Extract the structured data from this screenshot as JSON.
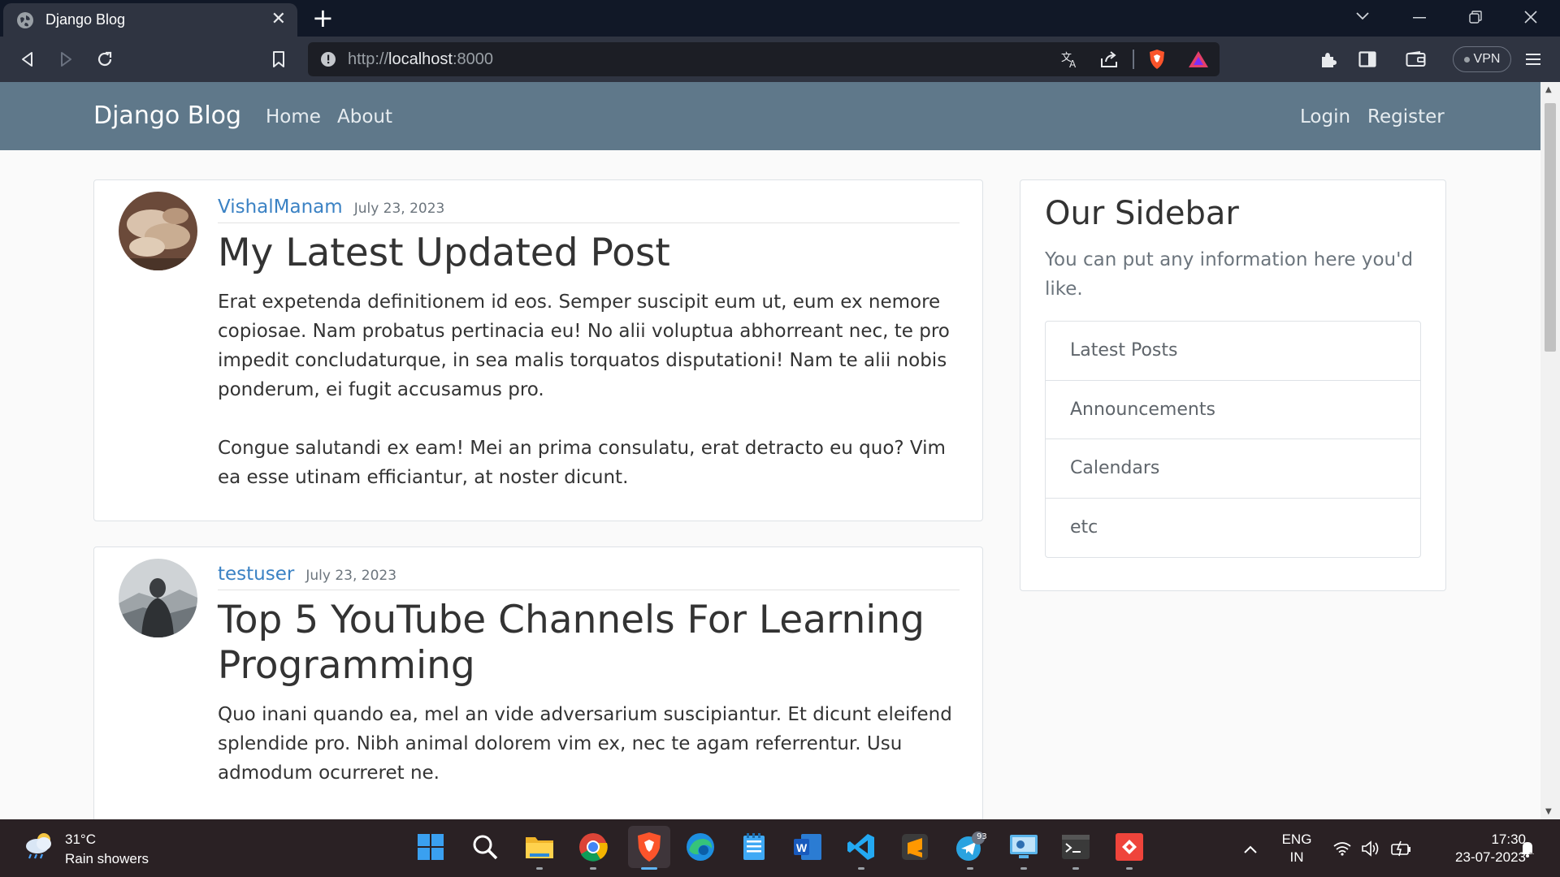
{
  "browser": {
    "tab_title": "Django Blog",
    "url_scheme": "http://",
    "url_host": "localhost",
    "url_port": ":8000",
    "vpn_label": "VPN"
  },
  "site": {
    "brand": "Django Blog",
    "nav_left": [
      "Home",
      "About"
    ],
    "nav_right": [
      "Login",
      "Register"
    ]
  },
  "posts": [
    {
      "author": "VishalManam",
      "date": "July 23, 2023",
      "title": "My Latest Updated Post",
      "paragraphs": [
        "Erat expetenda definitionem id eos. Semper suscipit eum ut, eum ex nemore copiosae. Nam probatus pertinacia eu! No alii voluptua abhorreant nec, te pro impedit concludaturque, in sea malis torquatos disputationi! Nam te alii nobis ponderum, ei fugit accusamus pro.",
        "Congue salutandi ex eam! Mei an prima consulatu, erat detracto eu quo? Vim ea esse utinam efficiantur, at noster dicunt."
      ]
    },
    {
      "author": "testuser",
      "date": "July 23, 2023",
      "title": "Top 5 YouTube Channels For Learning Programming",
      "paragraphs": [
        "Quo inani quando ea, mel an vide adversarium suscipiantur. Et dicunt eleifend splendide pro. Nibh animal dolorem vim ex, nec te agam referrentur. Usu admodum ocurreret ne."
      ]
    }
  ],
  "sidebar": {
    "heading": "Our Sidebar",
    "lead": "You can put any information here you'd like.",
    "items": [
      "Latest Posts",
      "Announcements",
      "Calendars",
      "etc"
    ]
  },
  "taskbar": {
    "temperature": "31°C",
    "weather": "Rain showers",
    "lang_top": "ENG",
    "lang_bottom": "IN",
    "time": "17:30",
    "date": "23-07-2023",
    "telegram_badge": "93"
  },
  "colors": {
    "navbar": "#5f788a",
    "link": "#3b82c4",
    "chrome_dark": "#111827",
    "chrome_toolbar": "#2f3441"
  }
}
